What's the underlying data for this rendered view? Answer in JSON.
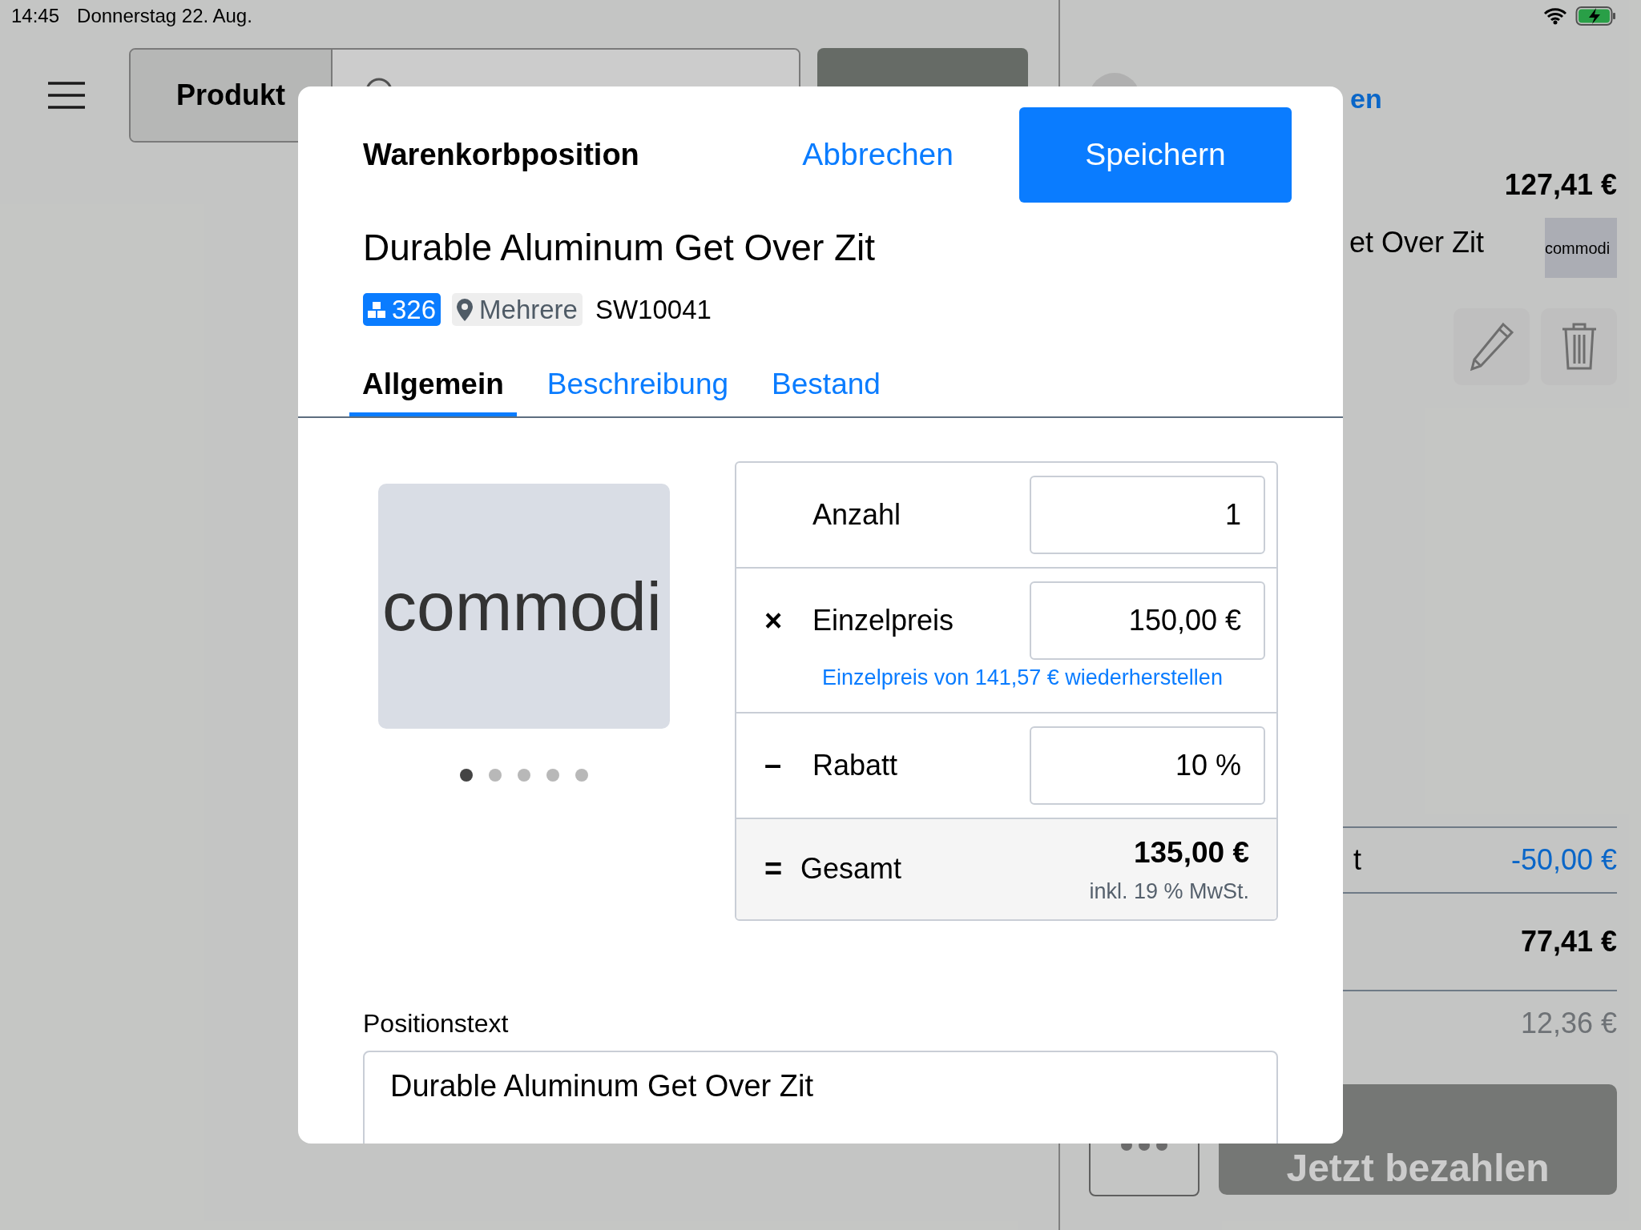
{
  "status_bar": {
    "time": "14:45",
    "date": "Donnerstag 22. Aug."
  },
  "background": {
    "segment": "Produkt",
    "account_link": "en",
    "cart_total": "127,41 €",
    "cart_item": {
      "name": "et Over Zit",
      "image_text": "commodi"
    },
    "summary": [
      {
        "kind": "discount",
        "label": "t",
        "value": "-50,00 €"
      },
      {
        "kind": "total",
        "value": "77,41 €"
      },
      {
        "kind": "tax",
        "value": "12,36 €"
      }
    ],
    "pay_button": "Jetzt bezahlen"
  },
  "dialog": {
    "title": "Warenkorbposition",
    "cancel": "Abbrechen",
    "save": "Speichern",
    "product": {
      "name": "Durable Aluminum Get Over Zit",
      "stock": "326",
      "location": "Mehrere",
      "sku": "SW10041"
    },
    "tabs": [
      {
        "label": "Allgemein",
        "selected": true
      },
      {
        "label": "Beschreibung",
        "selected": false
      },
      {
        "label": "Bestand",
        "selected": false
      }
    ],
    "image": {
      "text": "commodi"
    },
    "image_dots": [
      {
        "selected": true
      },
      {
        "selected": false
      },
      {
        "selected": false
      },
      {
        "selected": false
      },
      {
        "selected": false
      }
    ],
    "rows": [
      {
        "kind": "field",
        "label": "Anzahl",
        "value": "1"
      },
      {
        "kind": "field",
        "operator": "×",
        "label": "Einzelpreis",
        "value": "150,00 €",
        "link": "Einzelpreis von 141,57 € wiederherstellen"
      },
      {
        "kind": "field",
        "operator": "–",
        "label": "Rabatt",
        "value": "10 %"
      },
      {
        "kind": "total",
        "operator": "=",
        "label": "Gesamt",
        "value": "135,00 €",
        "note": "inkl. 19 % MwSt."
      }
    ],
    "position_text": {
      "label": "Positionstext",
      "value": "Durable Aluminum Get Over Zit"
    }
  }
}
